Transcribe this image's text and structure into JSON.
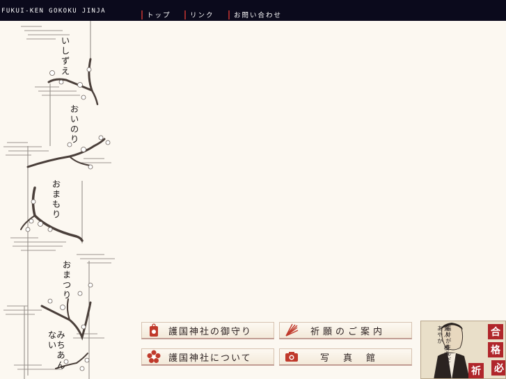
{
  "header": {
    "site_name": "FUKUI-KEN GOKOKU JINJA",
    "nav": [
      {
        "label": "トップ"
      },
      {
        "label": "リンク"
      },
      {
        "label": "お問い合わせ"
      }
    ]
  },
  "side_menu": [
    {
      "label": "いしずえ"
    },
    {
      "label": "おいのり"
    },
    {
      "label": "おまもり"
    },
    {
      "label": "おまつり"
    },
    {
      "label": "みちあんない"
    }
  ],
  "buttons": [
    {
      "label": "護国神社の御守り",
      "icon": "omamori-icon"
    },
    {
      "label": "祈願のご案内",
      "icon": "fan-icon"
    },
    {
      "label": "護国神社について",
      "icon": "plum-blossom-icon"
    },
    {
      "label": "写真館",
      "icon": "camera-icon"
    }
  ],
  "banner": {
    "text_line1": "福井が生んだ",
    "text_line2": "賢人 橋本左内にあやか",
    "kanji": [
      "合",
      "格",
      "必",
      "祈"
    ]
  },
  "colors": {
    "topbar": "#0b0a1c",
    "accent_red": "#9b2a2c",
    "background": "#fcf8f1",
    "branch": "#4a3f3a"
  }
}
